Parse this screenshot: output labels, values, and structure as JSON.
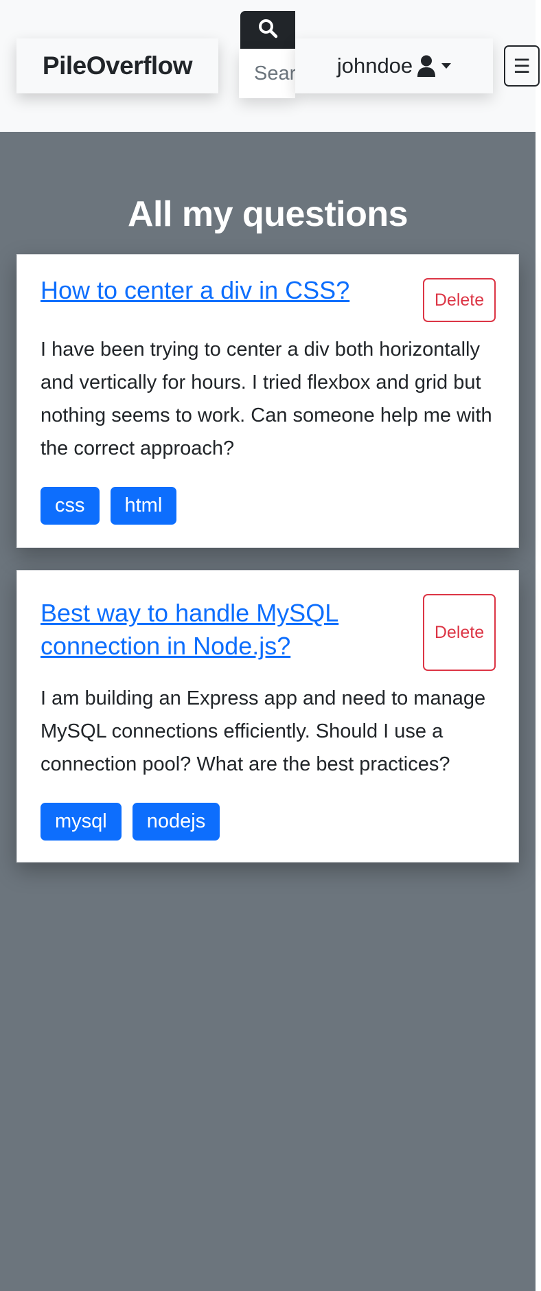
{
  "header": {
    "brand": "PileOverflow",
    "search_placeholder": "Search",
    "username": "johndoe",
    "menu_toggle_glyph": "☰"
  },
  "main": {
    "title": "All my questions",
    "questions": [
      {
        "title": "How to center a div in CSS?",
        "body": "I have been trying to center a div both horizontally and vertically for hours. I tried flexbox and grid but nothing seems to work. Can someone help me with the correct approach?",
        "tags": [
          "css",
          "html"
        ],
        "delete_label": "Delete"
      },
      {
        "title": "Best way to handle MySQL connection in Node.js?",
        "body": "I am building an Express app and need to manage MySQL connections efficiently. Should I use a connection pool? What are the best practices?",
        "tags": [
          "mysql",
          "nodejs"
        ],
        "delete_label": "Delete"
      }
    ]
  },
  "icons": {
    "search": "search-icon",
    "user": "user-icon",
    "dropdown": "caret-down-icon",
    "menu": "hamburger-icon"
  },
  "colors": {
    "primary": "#0d6efd",
    "danger": "#dc3545",
    "dark": "#212529",
    "light": "#f8f9fa",
    "page_background": "#6c757d"
  }
}
